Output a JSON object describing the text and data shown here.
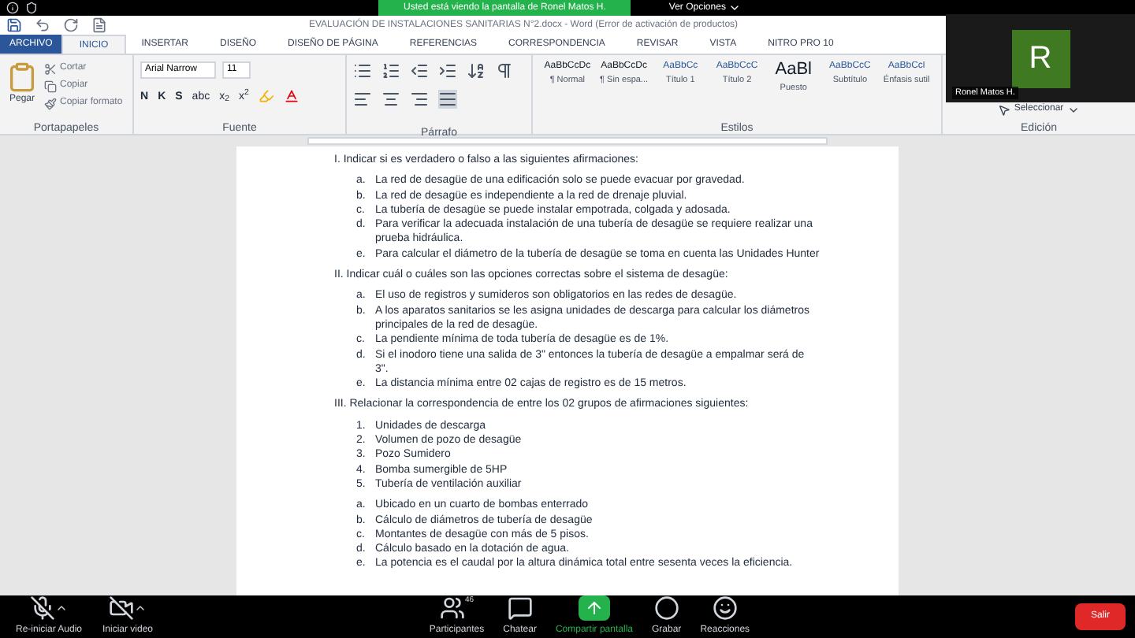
{
  "meeting_banner": {
    "text": "Usted está viendo la pantalla de Ronel Matos H.",
    "options": "Ver Opciones"
  },
  "window": {
    "title": "EVALUACIÓN DE INSTALACIONES SANITARIAS N°2.docx - Word (Error de activación de productos)"
  },
  "tabs": [
    {
      "label": "ARCHIVO",
      "kind": "file",
      "selected": false
    },
    {
      "label": "INICIO",
      "kind": "tab",
      "selected": true
    },
    {
      "label": "INSERTAR",
      "kind": "tab",
      "selected": false
    },
    {
      "label": "DISEÑO",
      "kind": "tab",
      "selected": false
    },
    {
      "label": "DISEÑO DE PÁGINA",
      "kind": "tab",
      "selected": false
    },
    {
      "label": "REFERENCIAS",
      "kind": "tab",
      "selected": false
    },
    {
      "label": "CORRESPONDENCIA",
      "kind": "tab",
      "selected": false
    },
    {
      "label": "REVISAR",
      "kind": "tab",
      "selected": false
    },
    {
      "label": "VISTA",
      "kind": "tab",
      "selected": false
    },
    {
      "label": "NITRO PRO 10",
      "kind": "tab",
      "selected": false
    }
  ],
  "ribbon": {
    "clipboard": {
      "paste": "Pegar",
      "items": [
        "Cortar",
        "Copiar",
        "Copiar formato"
      ],
      "label": "Portapapeles"
    },
    "font": {
      "name": "Arial Narrow",
      "size": "11",
      "buttons": [
        "N",
        "K",
        "S",
        "abc",
        "x$_{2}$",
        "x$^{2}$"
      ],
      "label": "Fuente"
    },
    "paragraph": {
      "label": "Párrafo"
    },
    "styles": {
      "items": [
        {
          "sample": "AaBbCcDc",
          "name": "¶ Normal"
        },
        {
          "sample": "AaBbCcDc",
          "name": "¶ Sin espa..."
        },
        {
          "sample": "AaBbCc",
          "name": "Título 1"
        },
        {
          "sample": "AaBbCcC",
          "name": "Título 2"
        },
        {
          "sample": "AaBl",
          "name": "Puesto"
        },
        {
          "sample": "AaBbCcC",
          "name": "Subtítulo"
        },
        {
          "sample": "AaBbCcl",
          "name": "Énfasis sutil"
        }
      ],
      "label": "Estilos"
    },
    "editing": {
      "select": "Seleccionar",
      "label": "Edición"
    }
  },
  "video": {
    "initial": "R",
    "name": "Ronel Matos H."
  },
  "document": {
    "sections": [
      {
        "heading": "I. Indicar si es verdadero o falso a las siguientes afirmaciones:",
        "lists": [
          [
            {
              "marker": "a.",
              "text": "La red de desagüe de una edificación solo se puede evacuar por gravedad."
            },
            {
              "marker": "b.",
              "text": "La red de desagüe es independiente a la red de drenaje pluvial."
            },
            {
              "marker": "c.",
              "text": "La tubería de desagüe se puede instalar empotrada, colgada y adosada."
            },
            {
              "marker": "d.",
              "text": "Para verificar la adecuada instalación de una tubería de desagüe se requiere realizar una prueba hidráulica."
            },
            {
              "marker": "e.",
              "text": "Para calcular el diámetro de la tubería de desagüe se toma en cuenta las Unidades Hunter"
            }
          ]
        ]
      },
      {
        "heading": "II. Indicar cuál o cuáles son las opciones correctas sobre el sistema de desagüe:",
        "lists": [
          [
            {
              "marker": "a.",
              "text": "El uso de registros y sumideros son obligatorios en las redes de desagüe."
            },
            {
              "marker": "b.",
              "text": "A los aparatos sanitarios se les asigna unidades de descarga para calcular los diámetros principales de la red de desagüe."
            },
            {
              "marker": "c.",
              "text": "La pendiente mínima de toda tubería de desagüe es de 1%."
            },
            {
              "marker": "d.",
              "text": "Si el inodoro tiene una salida de 3\" entonces la tubería de desagüe a empalmar será de 3\"."
            },
            {
              "marker": "e.",
              "text": "La distancia mínima entre 02 cajas de registro es de 15 metros."
            }
          ]
        ]
      },
      {
        "heading": "III. Relacionar la correspondencia de entre los 02 grupos de afirmaciones siguientes:",
        "lists": [
          [
            {
              "marker": "1.",
              "text": "Unidades de descarga"
            },
            {
              "marker": "2.",
              "text": "Volumen de pozo de desagüe"
            },
            {
              "marker": "3.",
              "text": "Pozo Sumidero"
            },
            {
              "marker": "4.",
              "text": "Bomba sumergible de 5HP"
            },
            {
              "marker": "5.",
              "text": "Tubería de ventilación auxiliar"
            }
          ],
          [
            {
              "marker": "a.",
              "text": "Ubicado en un cuarto de bombas enterrado"
            },
            {
              "marker": "b.",
              "text": "Cálculo de diámetros de tubería de desagüe"
            },
            {
              "marker": "c.",
              "text": "Montantes de desagüe con más de 5 pisos."
            },
            {
              "marker": "d.",
              "text": "Cálculo basado en la dotación de agua."
            },
            {
              "marker": "e.",
              "text": "La potencia es el caudal por la altura dinámica total entre sesenta veces la eficiencia."
            }
          ]
        ]
      }
    ]
  },
  "toolbar": {
    "items": [
      {
        "label": "Re-iniciar Audio",
        "kind": "audio"
      },
      {
        "label": "Iniciar video",
        "kind": "video"
      },
      {
        "label": "Participantes",
        "kind": "participants",
        "count": "46"
      },
      {
        "label": "Chatear",
        "kind": "chat"
      },
      {
        "label": "Compartir pantalla",
        "kind": "share"
      },
      {
        "label": "Grabar",
        "kind": "record"
      },
      {
        "label": "Reacciones",
        "kind": "reactions"
      }
    ],
    "leave": "Salir"
  }
}
